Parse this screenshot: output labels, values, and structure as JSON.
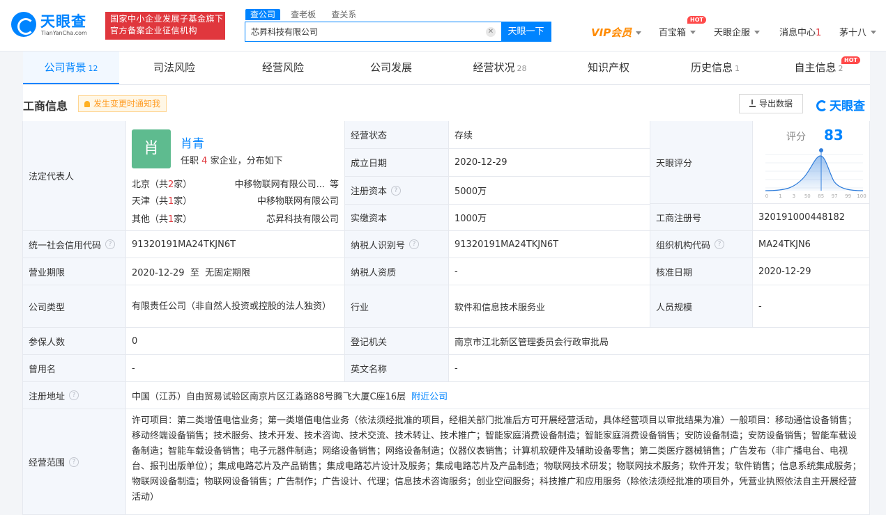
{
  "header": {
    "logo_text": "天眼查",
    "logo_domain": "TianYanCha.com",
    "badge_line1": "国家中小企业发展子基金旗下",
    "badge_line2": "官方备案企业征信机构",
    "search_tabs": [
      "查公司",
      "查老板",
      "查关系"
    ],
    "search_value": "芯昇科技有限公司",
    "search_button": "天眼一下",
    "nav": {
      "vip": "VIP会员",
      "toolbox": "百宝箱",
      "toolbox_badge": "HOT",
      "enterprise": "天眼企服",
      "messages": "消息中心",
      "message_count": "1",
      "user": "茅十八"
    }
  },
  "tabs": [
    {
      "label": "公司背景",
      "count": "12"
    },
    {
      "label": "司法风险",
      "count": ""
    },
    {
      "label": "经营风险",
      "count": ""
    },
    {
      "label": "公司发展",
      "count": ""
    },
    {
      "label": "经营状况",
      "count": "28"
    },
    {
      "label": "知识产权",
      "count": ""
    },
    {
      "label": "历史信息",
      "count": "1"
    },
    {
      "label": "自主信息",
      "count": "2"
    }
  ],
  "tab_hot_badge": "HOT",
  "section": {
    "title": "工商信息",
    "notify": "发生变更时通知我",
    "export": "导出数据",
    "brand": "天眼查"
  },
  "info": {
    "legal_rep": {
      "label": "法定代表人",
      "avatar": "肖",
      "name": "肖青",
      "sub_prefix": "任职",
      "sub_count": "4",
      "sub_suffix": "家企业，分布如下",
      "locations": [
        {
          "prefix": "北京（共",
          "count": "2",
          "suffix": "家）",
          "company": "中移物联网有限公司...",
          "extra": "等"
        },
        {
          "prefix": "天津（共",
          "count": "1",
          "suffix": "家）",
          "company": "中移物联网有限公司",
          "extra": ""
        },
        {
          "prefix": "其他（共",
          "count": "1",
          "suffix": "家）",
          "company": "芯昇科技有限公司",
          "extra": ""
        }
      ]
    },
    "status": {
      "label": "经营状态",
      "value": "存续"
    },
    "established": {
      "label": "成立日期",
      "value": "2020-12-29"
    },
    "reg_capital": {
      "label": "注册资本",
      "value": "5000万"
    },
    "paid_capital": {
      "label": "实缴资本",
      "value": "1000万"
    },
    "score": {
      "label": "天眼评分",
      "title": "评分",
      "value": 83,
      "axis": [
        "0",
        "1",
        "3",
        "50",
        "85",
        "97",
        "99",
        "100"
      ]
    },
    "reg_no": {
      "label": "工商注册号",
      "value": "320191000448182"
    },
    "credit_code": {
      "label": "统一社会信用代码",
      "value": "91320191MA24TKJN6T"
    },
    "taxpayer_id": {
      "label": "纳税人识别号",
      "value": "91320191MA24TKJN6T"
    },
    "org_code": {
      "label": "组织机构代码",
      "value": "MA24TKJN6"
    },
    "term": {
      "label": "营业期限",
      "value": "2020-12-29  至  无固定期限"
    },
    "taxpayer_qual": {
      "label": "纳税人资质",
      "value": "-"
    },
    "approval_date": {
      "label": "核准日期",
      "value": "2020-12-29"
    },
    "company_type": {
      "label": "公司类型",
      "value": "有限责任公司（非自然人投资或控股的法人独资）"
    },
    "industry": {
      "label": "行业",
      "value": "软件和信息技术服务业"
    },
    "staff_size": {
      "label": "人员规模",
      "value": "-"
    },
    "insured": {
      "label": "参保人数",
      "value": "0"
    },
    "authority": {
      "label": "登记机关",
      "value": "南京市江北新区管理委员会行政审批局"
    },
    "former_name": {
      "label": "曾用名",
      "value": "-"
    },
    "english_name": {
      "label": "英文名称",
      "value": "-"
    },
    "address": {
      "label": "注册地址",
      "value": "中国（江苏）自由贸易试验区南京片区江淼路88号腾飞大厦C座16层",
      "link": "附近公司"
    },
    "scope": {
      "label": "经营范围",
      "value": "许可项目：第二类增值电信业务；第一类增值电信业务（依法须经批准的项目，经相关部门批准后方可开展经营活动，具体经营项目以审批结果为准）一般项目：移动通信设备销售；移动终端设备销售；技术服务、技术开发、技术咨询、技术交流、技术转让、技术推广；智能家庭消费设备制造；智能家庭消费设备销售；安防设备制造；安防设备销售；智能车载设备制造；智能车载设备销售；电子元器件制造；网络设备销售；网络设备制造；仪器仪表销售；计算机软硬件及辅助设备零售；第二类医疗器械销售；广告发布（非广播电台、电视台、报刊出版单位）；集成电路芯片及产品销售；集成电路芯片设计及服务；集成电路芯片及产品制造；物联网技术研发；物联网技术服务；软件开发；软件销售；信息系统集成服务；物联网设备制造；物联网设备销售；广告制作；广告设计、代理；信息技术咨询服务；创业空间服务；科技推广和应用服务（除依法须经批准的项目外，凭营业执照依法自主开展经营活动）"
    }
  },
  "colors": {
    "brand": "#0084ff",
    "accent_red": "#e0373d",
    "vip": "#ff8a00",
    "label_bg": "#f4f7fc"
  }
}
